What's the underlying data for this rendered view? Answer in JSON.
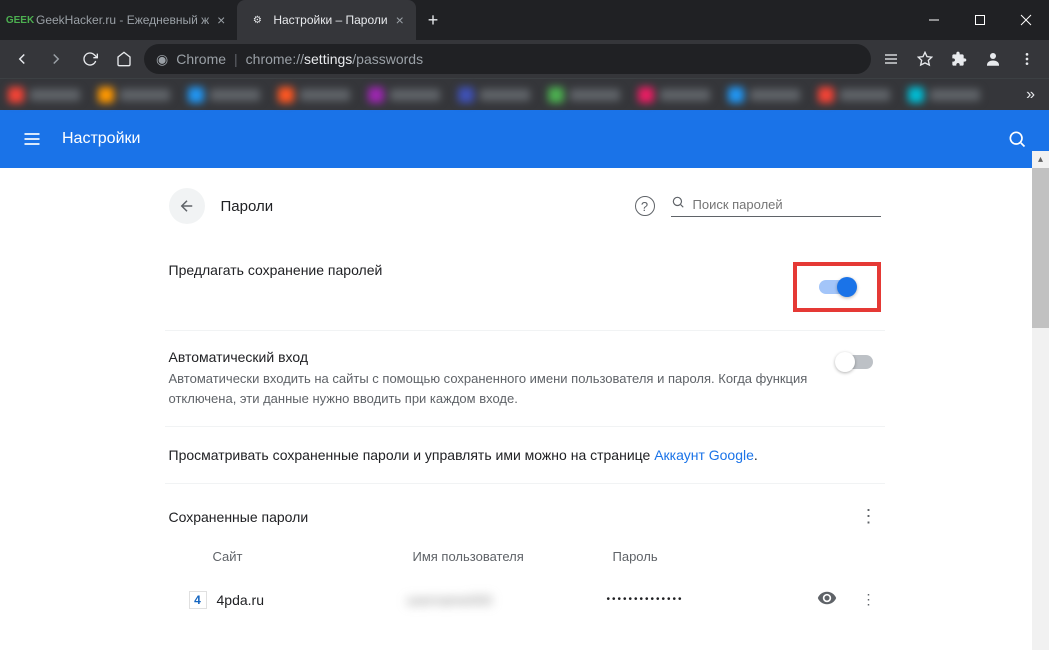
{
  "tabs": [
    {
      "title": "GeekHacker.ru - Ежедневный ж",
      "favicon_text": "GEEK",
      "active": false
    },
    {
      "title": "Настройки – Пароли",
      "favicon_text": "⚙",
      "active": true
    }
  ],
  "omnibox": {
    "label": "Chrome",
    "url_prefix": "chrome://",
    "url_highlight": "settings",
    "url_suffix": "/passwords"
  },
  "header": {
    "title": "Настройки"
  },
  "page": {
    "title": "Пароли",
    "search_placeholder": "Поиск паролей",
    "offer_save": {
      "title": "Предлагать сохранение паролей"
    },
    "auto_login": {
      "title": "Автоматический вход",
      "desc": "Автоматически входить на сайты с помощью сохраненного имени пользователя и пароля. Когда функция отключена, эти данные нужно вводить при каждом входе."
    },
    "manage_text": "Просматривать сохраненные пароли и управлять ими можно на странице ",
    "manage_link": "Аккаунт Google",
    "saved_title": "Сохраненные пароли",
    "columns": {
      "site": "Сайт",
      "user": "Имя пользователя",
      "pass": "Пароль"
    },
    "rows": [
      {
        "site": "4pda.ru",
        "user": "username000",
        "pass": "••••••••••••••"
      }
    ]
  }
}
